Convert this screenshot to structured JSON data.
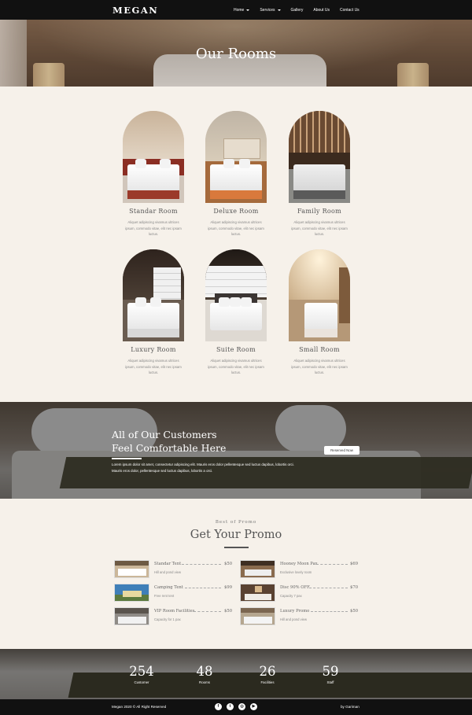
{
  "nav": {
    "brand": "MEGAN",
    "items": [
      {
        "label": "Home",
        "dropdown": true
      },
      {
        "label": "Services",
        "dropdown": true
      },
      {
        "label": "Gallery",
        "dropdown": false
      },
      {
        "label": "About Us",
        "dropdown": false
      },
      {
        "label": "Contact Us",
        "dropdown": false
      }
    ]
  },
  "hero": {
    "title": "Our Rooms"
  },
  "rooms": [
    {
      "name": "Standar Room",
      "desc": "Aliquet adipiscing vivamus ultrices ipsum, commodo vitae, elit nec ipsam luctus."
    },
    {
      "name": "Deluxe Room",
      "desc": "Aliquet adipiscing vivamus ultrices ipsum, commodo vitae, elit nec ipsam luctus."
    },
    {
      "name": "Family Room",
      "desc": "Aliquet adipiscing vivamus ultrices ipsum, commodo vitae, elit nec ipsam luctus."
    },
    {
      "name": "Luxury Room",
      "desc": "Aliquet adipiscing vivamus ultrices ipsum, commodo vitae, elit nec ipsam luctus."
    },
    {
      "name": "Suite Room",
      "desc": "Aliquet adipiscing vivamus ultrices ipsum, commodo vitae, elit nec ipsam luctus."
    },
    {
      "name": "Small Room",
      "desc": "Aliquet adipiscing vivamus ultrices ipsum, commodo vitae, elit nec ipsam luctus."
    }
  ],
  "banner": {
    "line1": "All of Our Customers",
    "line2": "Feel Comfortable Here",
    "text": "Lorem ipsum dolor sit amet, consectetur adipiscing elit. Mauris eros dolor pellentesque sed luctus dapibus, lobortis orci. Mauris eros dolor, pellentesque sed luctus dapibus, lobortis a orci.",
    "button": "Reserved Now"
  },
  "promo": {
    "kicker": "Best of Promo",
    "title": "Get Your Promo",
    "items": [
      {
        "name": "Standar Tent",
        "price": "$50",
        "desc": "Hill and pond view"
      },
      {
        "name": "Hooney Moon Pax",
        "price": "$69",
        "desc": "Exclusive lovely room"
      },
      {
        "name": "Camping Tent",
        "price": "$99",
        "desc": "Free rent tent"
      },
      {
        "name": "Disc 90% OFF",
        "price": "$70",
        "desc": "Capacity 7 pax"
      },
      {
        "name": "VIP Room Facilities",
        "price": "$50",
        "desc": "Capacity for 1 pax"
      },
      {
        "name": "Luxury Promo",
        "price": "$50",
        "desc": "Hill and pond view"
      }
    ]
  },
  "stats": [
    {
      "value": "254",
      "label": "Customer"
    },
    {
      "value": "48",
      "label": "Rooms"
    },
    {
      "value": "26",
      "label": "Facilities"
    },
    {
      "value": "59",
      "label": "Staff"
    }
  ],
  "footer": {
    "copyright": "Megan 2020 © All Right Reserved",
    "credit": "by Gariman",
    "socials": [
      {
        "icon": "facebook-icon",
        "glyph": "f"
      },
      {
        "icon": "twitter-icon",
        "glyph": "t"
      },
      {
        "icon": "instagram-icon",
        "glyph": "◎"
      },
      {
        "icon": "youtube-icon",
        "glyph": "▶"
      }
    ]
  }
}
